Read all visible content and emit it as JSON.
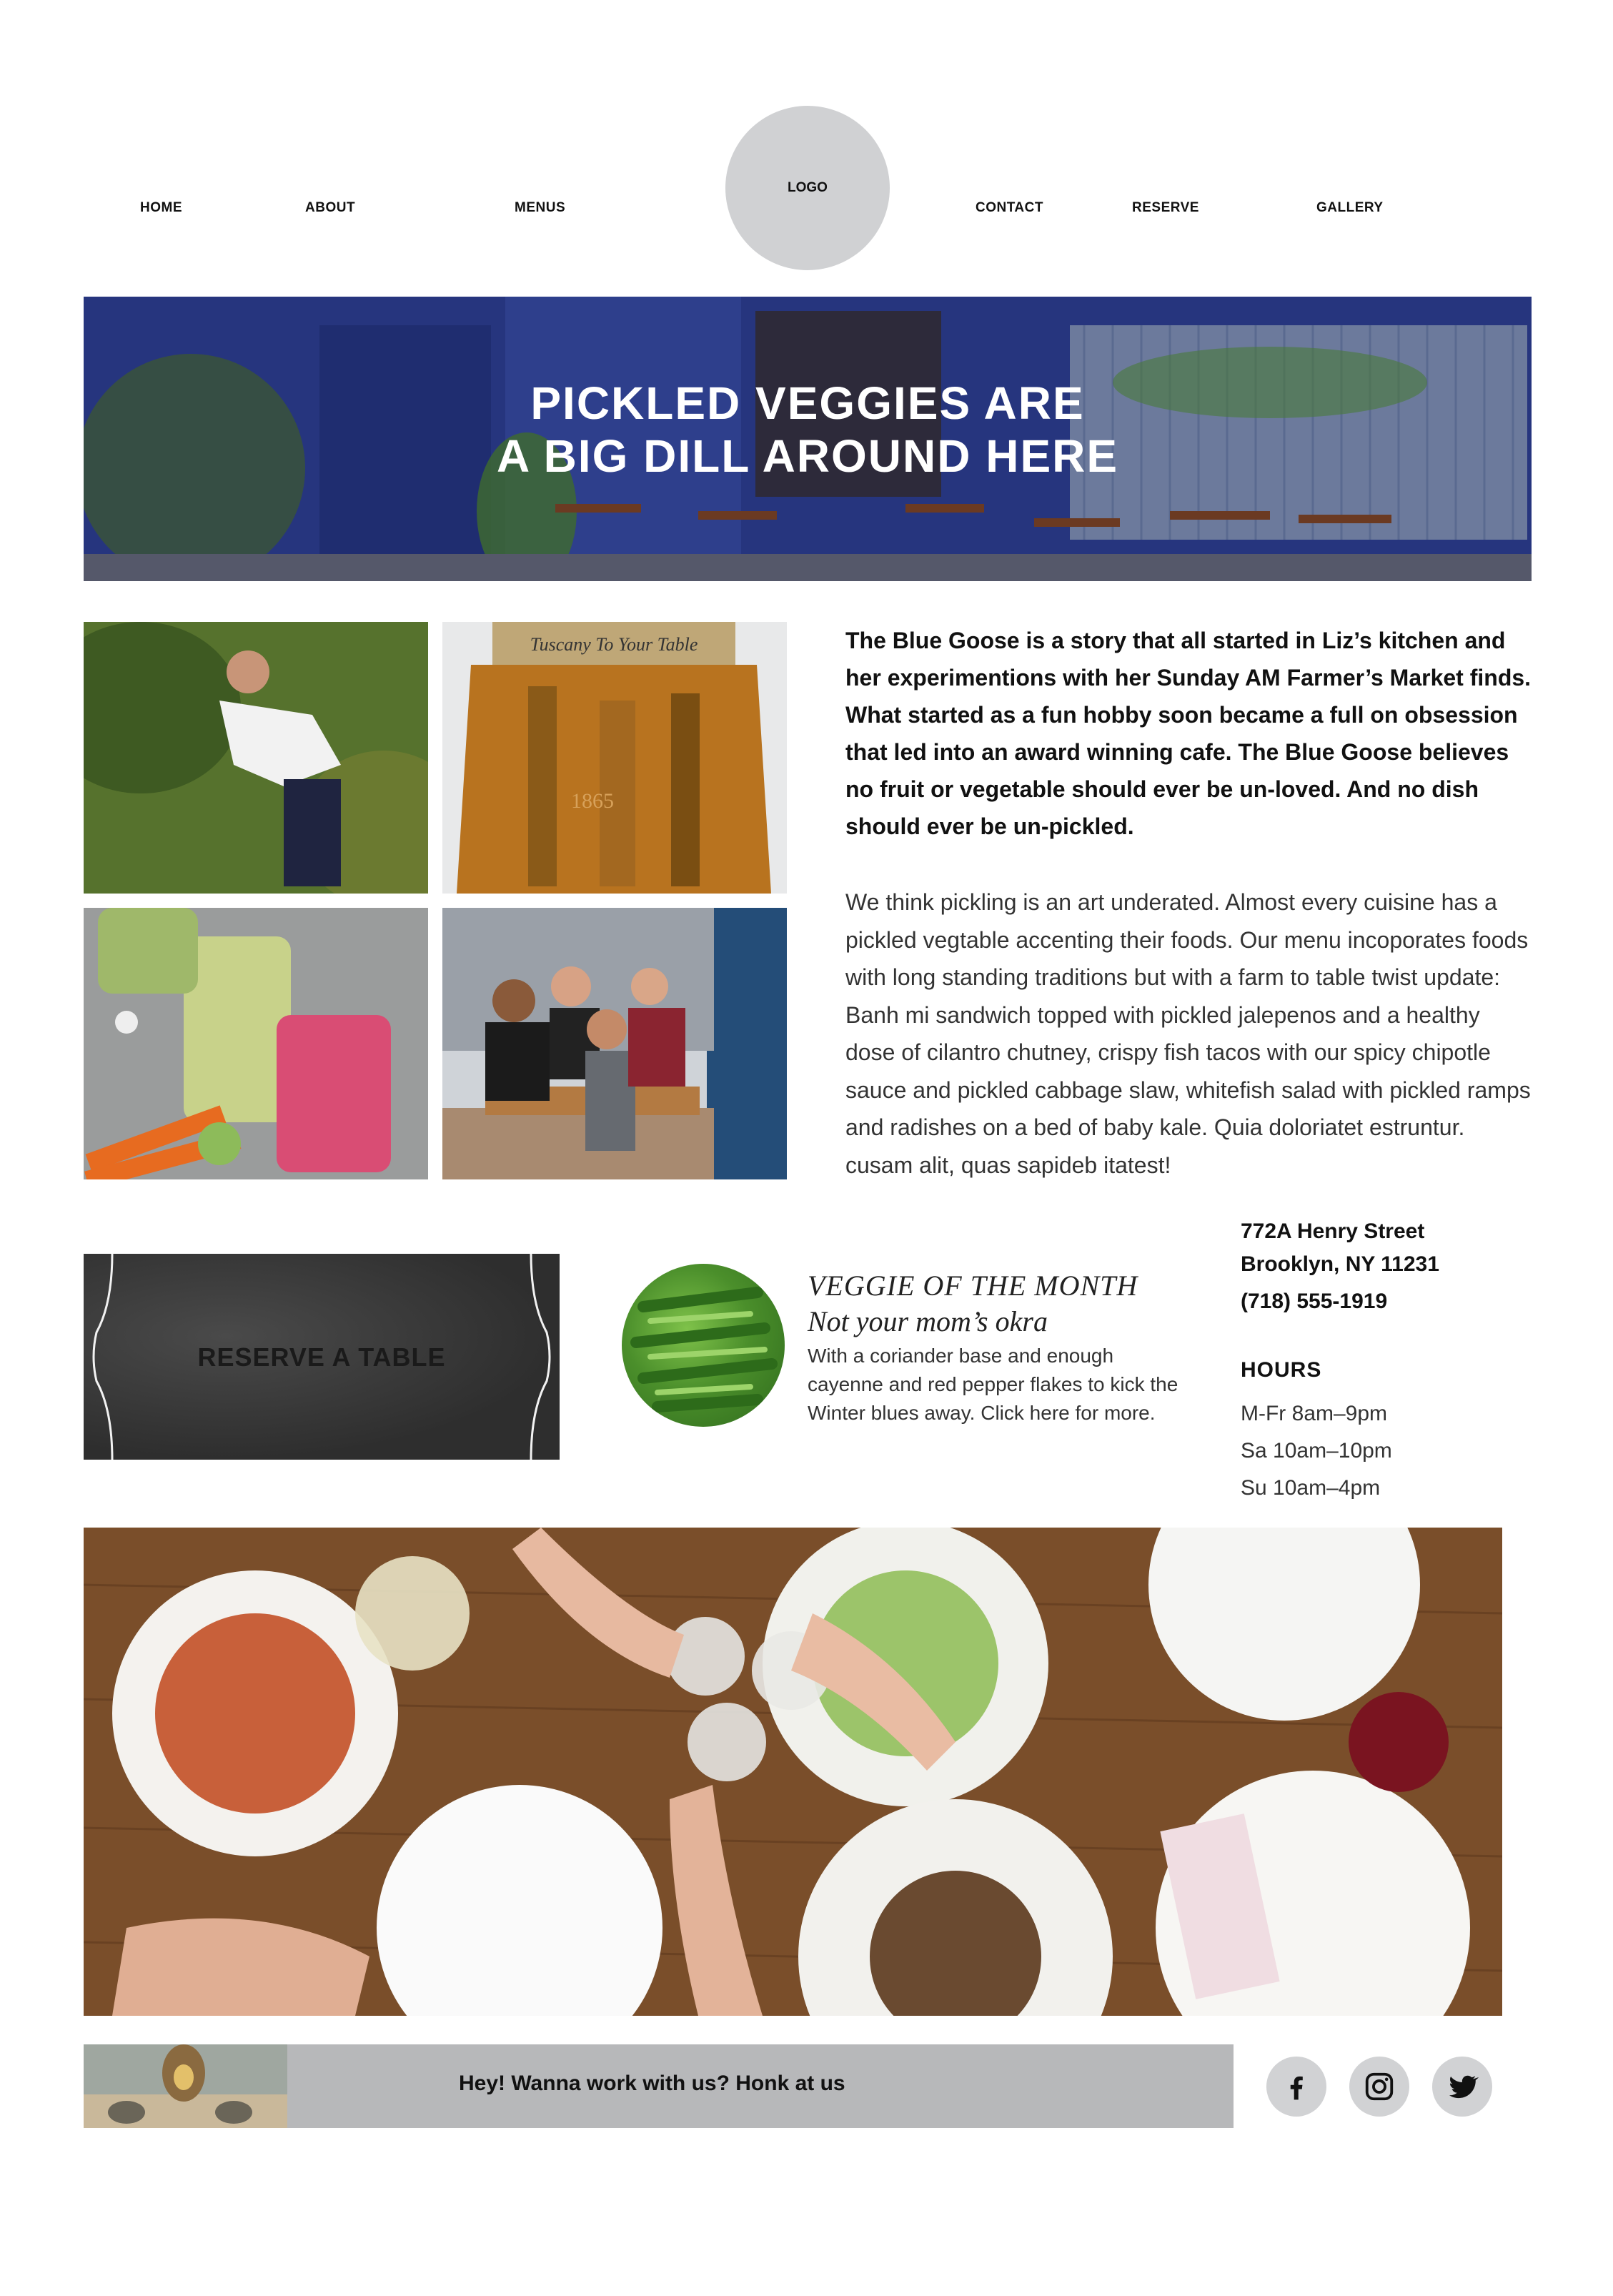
{
  "nav": {
    "home": "HOME",
    "about": "ABOUT",
    "menus": "MENUS",
    "logo": "LOGO",
    "contact": "CONTACT",
    "reserve": "RESERVE",
    "gallery": "GALLERY"
  },
  "hero": {
    "line1": "PICKLED VEGGIES ARE",
    "line2": "A BIG DILL AROUND HERE"
  },
  "photos": {
    "jar_label": "Tuscany To Your Table",
    "jar_emboss": "1865"
  },
  "about": {
    "bold": "The Blue Goose is a story that all started in Liz’s kitchen and her experimentions with her Sunday AM Farmer’s Market finds. What started as a fun hobby soon became a full on obsession that led into an award winning cafe. The Blue Goose believes no fruit or vegetable should ever be un-loved. And no dish should ever be un-pickled.",
    "body": "We think pickling is an art underated. Almost every cuisine has a pickled vegtable accenting their foods. Our menu incoporates foods with long standing traditions but with a farm to table twist update: Banh mi sandwich topped with pickled jalepenos and a healthy dose of cilantro chutney, crispy fish tacos with our spicy chipotle sauce and pickled cabbage slaw, whitefish salad with pickled ramps and radishes on a bed of baby kale. Quia doloriatet estruntur. cusam alit, quas sapideb itatest!"
  },
  "reserve": {
    "label": "RESERVE A TABLE"
  },
  "veggie": {
    "title": "VEGGIE OF THE MONTH",
    "subtitle": "Not your mom’s okra",
    "body": "With a coriander base and enough cayenne and red pepper flakes to kick the Winter blues away. Click here for more."
  },
  "contact": {
    "street": "772A Henry Street",
    "city": "Brooklyn, NY 11231",
    "phone": "(718) 555-1919",
    "hours_heading": "HOURS",
    "hours": [
      "M-Fr 8am–9pm",
      "Sa 10am–10pm",
      "Su 10am–4pm"
    ]
  },
  "footer": {
    "cta": "Hey! Wanna work with us? Honk at us",
    "social": [
      "facebook-icon",
      "instagram-icon",
      "twitter-icon"
    ]
  },
  "colors": {
    "hero_blue": "#2a3c8a",
    "logo_gray": "#d0d1d3",
    "bar_gray": "#b7b8ba",
    "chalkboard": "#3a3a3a"
  }
}
